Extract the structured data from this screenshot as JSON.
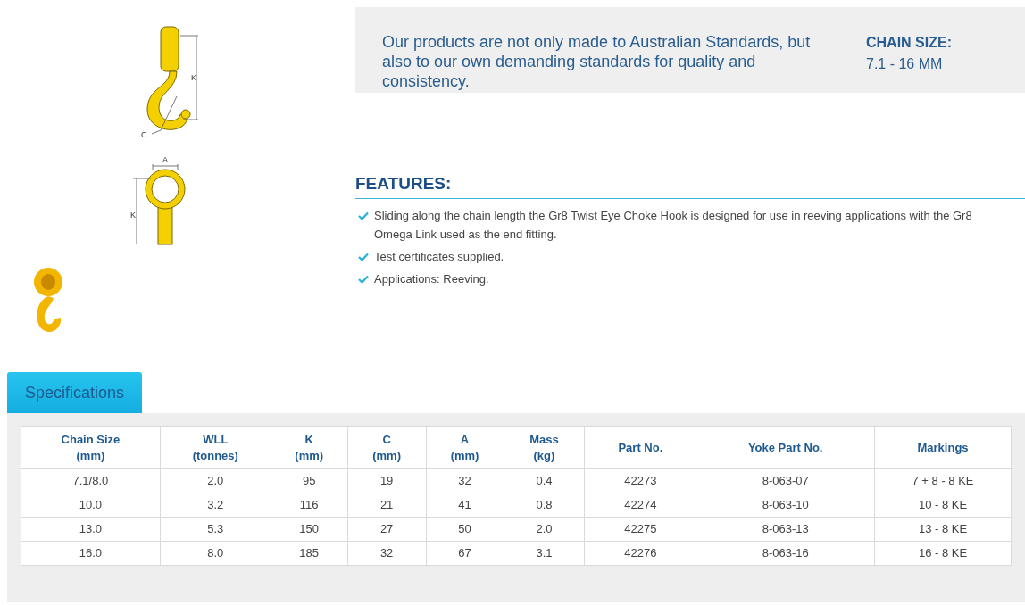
{
  "diagrams": {
    "hook_labels": [
      "K",
      "C"
    ],
    "eye_labels": [
      "A",
      "K"
    ]
  },
  "intro": {
    "text": "Our products are not only made to Australian Standards, but also to our own demanding standards for quality and consistency.",
    "chain_size_label": "CHAIN SIZE:",
    "chain_size_value": "7.1 - 16 MM"
  },
  "features": {
    "title": "FEATURES:",
    "items": [
      "Sliding along the chain length the Gr8 Twist Eye Choke Hook is designed for use in reeving applications with the Gr8 Omega Link used as the end fitting.",
      "Test certificates supplied.",
      "Applications: Reeving."
    ]
  },
  "tabs": [
    {
      "label": "Specifications",
      "selected": true
    }
  ],
  "table": {
    "columns": [
      "Chain Size\n(mm)",
      "WLL\n(tonnes)",
      "K\n(mm)",
      "C\n(mm)",
      "A\n(mm)",
      "Mass\n(kg)",
      "Part No.",
      "Yoke Part No.",
      "Markings"
    ],
    "rows": [
      [
        "7.1/8.0",
        "2.0",
        "95",
        "19",
        "32",
        "0.4",
        "42273",
        "8-063-07",
        "7 + 8 - 8 KE"
      ],
      [
        "10.0",
        "3.2",
        "116",
        "21",
        "41",
        "0.8",
        "42274",
        "8-063-10",
        "10 - 8 KE"
      ],
      [
        "13.0",
        "5.3",
        "150",
        "27",
        "50",
        "2.0",
        "42275",
        "8-063-13",
        "13 - 8 KE"
      ],
      [
        "16.0",
        "8.0",
        "185",
        "32",
        "67",
        "3.1",
        "42276",
        "8-063-16",
        "16 - 8 KE"
      ]
    ]
  }
}
